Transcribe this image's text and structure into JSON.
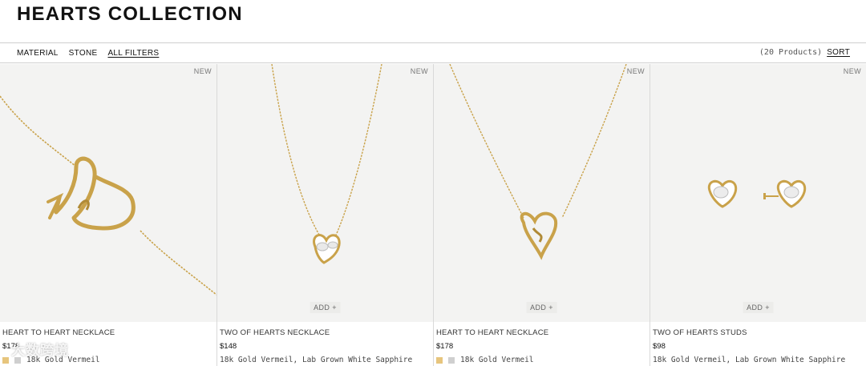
{
  "header": {
    "title": "HEARTS COLLECTION"
  },
  "filters": {
    "material_label": "MATERIAL",
    "stone_label": "STONE",
    "all_filters_label": "ALL FILTERS",
    "count_text": "(20 Products)",
    "sort_label": "SORT"
  },
  "products": [
    {
      "badge": "NEW",
      "name": "HEART TO HEART NECKLACE",
      "price": "$178",
      "material": "18k Gold Vermeil",
      "add_label": "",
      "swatches": [
        "#e7c57d",
        "#cfcfcf"
      ]
    },
    {
      "badge": "NEW",
      "name": "TWO OF HEARTS NECKLACE",
      "price": "$148",
      "material": "18k Gold Vermeil, Lab Grown White Sapphire",
      "add_label": "ADD +",
      "swatches": []
    },
    {
      "badge": "NEW",
      "name": "HEART TO HEART NECKLACE",
      "price": "$178",
      "material": "18k Gold Vermeil",
      "add_label": "ADD +",
      "swatches": [
        "#e7c57d",
        "#cfcfcf"
      ]
    },
    {
      "badge": "NEW",
      "name": "TWO OF HEARTS STUDS",
      "price": "$98",
      "material": "18k Gold Vermeil, Lab Grown White Sapphire",
      "add_label": "ADD +",
      "swatches": []
    }
  ],
  "watermark": "大数跨境",
  "colors": {
    "gold": "#c9a24a",
    "image_bg": "#f3f3f2",
    "border": "#d9d9d9"
  }
}
